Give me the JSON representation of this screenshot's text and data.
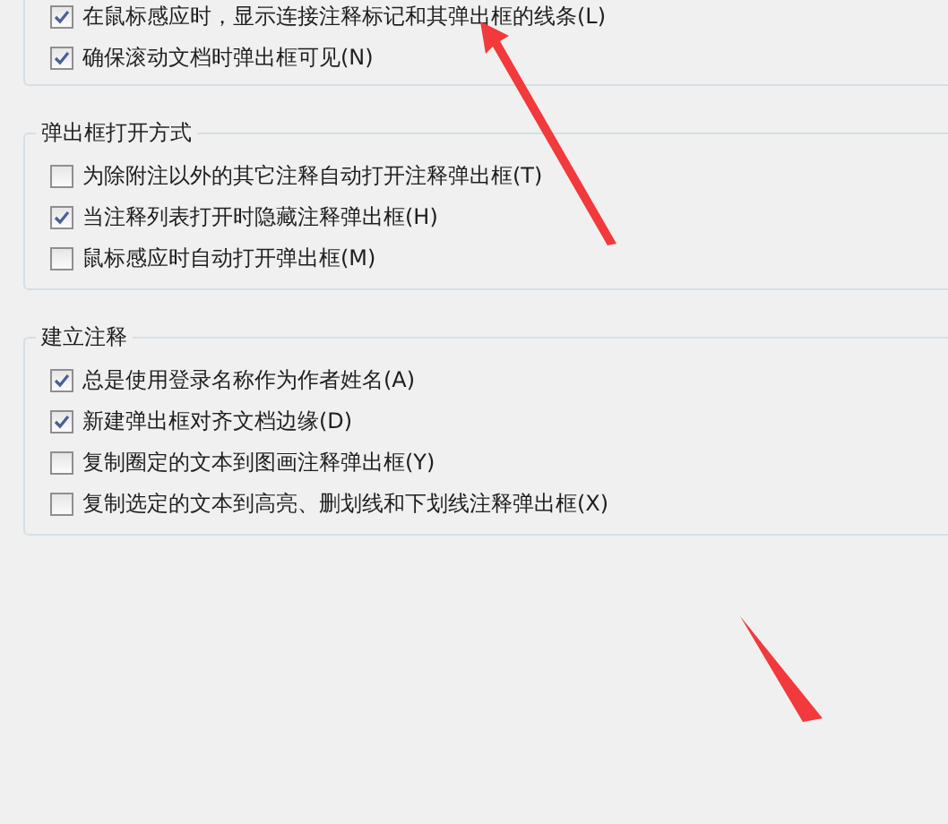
{
  "groups": [
    {
      "options": [
        {
          "label": "在鼠标感应时，显示连接注释标记和其弹出框的线条(L)",
          "checked": true
        },
        {
          "label": "确保滚动文档时弹出框可见(N)",
          "checked": true
        }
      ]
    },
    {
      "title": "弹出框打开方式",
      "options": [
        {
          "label": "为除附注以外的其它注释自动打开注释弹出框(T)",
          "checked": false
        },
        {
          "label": "当注释列表打开时隐藏注释弹出框(H)",
          "checked": true
        },
        {
          "label": "鼠标感应时自动打开弹出框(M)",
          "checked": false
        }
      ]
    },
    {
      "title": "建立注释",
      "options": [
        {
          "label": "总是使用登录名称作为作者姓名(A)",
          "checked": true
        },
        {
          "label": "新建弹出框对齐文档边缘(D)",
          "checked": true
        },
        {
          "label": "复制圈定的文本到图画注释弹出框(Y)",
          "checked": false
        },
        {
          "label": "复制选定的文本到高亮、删划线和下划线注释弹出框(X)",
          "checked": false
        }
      ]
    }
  ]
}
